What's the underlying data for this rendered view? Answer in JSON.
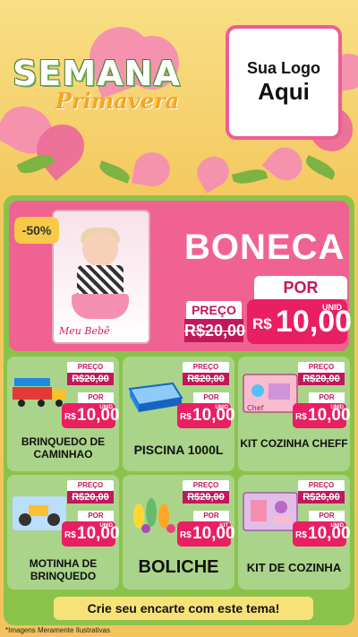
{
  "header": {
    "title": "SEMANA",
    "subtitle": "Primavera",
    "logo_line1": "Sua Logo",
    "logo_line2": "Aqui"
  },
  "hero": {
    "discount": "-50%",
    "name": "BONECA",
    "price_label": "PREÇO",
    "old_price": "R$20,00",
    "por_label": "POR",
    "currency": "R$",
    "new_price": "10,00",
    "unit": "UNID",
    "box_label": "Meu Bebê"
  },
  "products": [
    {
      "name": "BRINQUEDO DE CAMINHAO",
      "price_label": "PREÇO",
      "old_price": "R$20,00",
      "por_label": "POR",
      "currency": "R$",
      "new_price": "10,00",
      "unit": "UNID"
    },
    {
      "name": "PISCINA 1000L",
      "price_label": "PREÇO",
      "old_price": "R$20,00",
      "por_label": "POR",
      "currency": "R$",
      "new_price": "10,00",
      "unit": "UNID"
    },
    {
      "name": "KIT COZINHA CHEFF",
      "price_label": "PREÇO",
      "old_price": "R$20,00",
      "por_label": "POR",
      "currency": "R$",
      "new_price": "10,00",
      "unit": "UNID"
    },
    {
      "name": "MOTINHA DE BRINQUEDO",
      "price_label": "PREÇO",
      "old_price": "R$20,00",
      "por_label": "POR",
      "currency": "R$",
      "new_price": "10,00",
      "unit": "UNID"
    },
    {
      "name": "BOLICHE",
      "price_label": "PREÇO",
      "old_price": "R$20,00",
      "por_label": "POR",
      "currency": "R$",
      "new_price": "10,00",
      "unit": "KIT"
    },
    {
      "name": "KIT DE COZINHA",
      "price_label": "PREÇO",
      "old_price": "R$20,00",
      "por_label": "POR",
      "currency": "R$",
      "new_price": "10,00",
      "unit": "UNID"
    }
  ],
  "footer": {
    "cta": "Crie seu encarte com este tema!",
    "disclaimer": "*Imagens Meramente Ilustrativas"
  },
  "colors": {
    "pink": "#e91e63",
    "dark_pink": "#c2185b",
    "green": "#8bc34a",
    "yellow": "#f7c948"
  }
}
